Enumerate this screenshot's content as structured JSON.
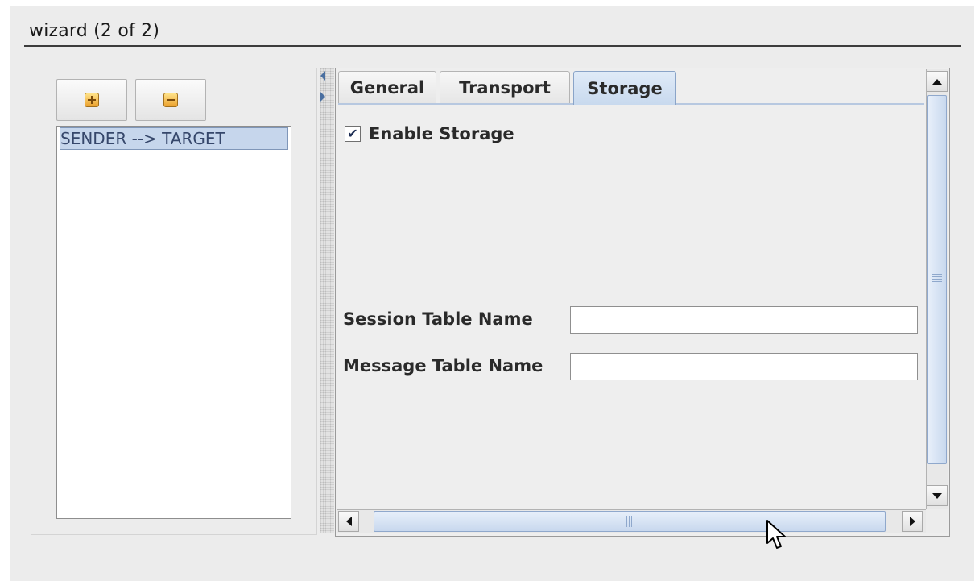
{
  "window": {
    "title": "wizard (2 of 2)"
  },
  "route_list": {
    "add_button_icon": "add-icon",
    "remove_button_icon": "remove-icon",
    "items": [
      {
        "label": "SENDER --> TARGET",
        "selected": true
      }
    ]
  },
  "tabs": [
    {
      "label": "General",
      "active": false
    },
    {
      "label": "Transport",
      "active": false
    },
    {
      "label": "Storage",
      "active": true
    }
  ],
  "storage": {
    "enable_storage": {
      "label": "Enable Storage",
      "checked": true
    },
    "session_table": {
      "label": "Session Table Name",
      "value": ""
    },
    "message_table": {
      "label": "Message Table Name",
      "value": ""
    }
  },
  "colors": {
    "selection": "#c6d6ec",
    "active_tab": "#c8d9ee",
    "accent_icon": "#eba12e"
  }
}
